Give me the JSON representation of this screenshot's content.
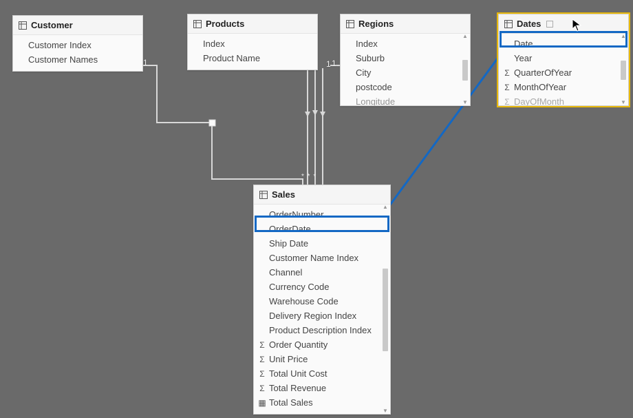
{
  "tables": {
    "customer": {
      "title": "Customer",
      "fields": [
        {
          "label": "Customer Index"
        },
        {
          "label": "Customer Names"
        }
      ]
    },
    "products": {
      "title": "Products",
      "fields": [
        {
          "label": "Index"
        },
        {
          "label": "Product Name"
        }
      ]
    },
    "regions": {
      "title": "Regions",
      "fields": [
        {
          "label": "Index"
        },
        {
          "label": "Suburb"
        },
        {
          "label": "City"
        },
        {
          "label": "postcode"
        },
        {
          "label": "Longitude"
        }
      ]
    },
    "dates": {
      "title": "Dates",
      "fields": [
        {
          "label": "Date"
        },
        {
          "label": "Year"
        },
        {
          "label": "QuarterOfYear",
          "sigma": true
        },
        {
          "label": "MonthOfYear",
          "sigma": true
        },
        {
          "label": "DayOfMonth",
          "sigma": true
        }
      ]
    },
    "sales": {
      "title": "Sales",
      "fields": [
        {
          "label": "OrderNumber"
        },
        {
          "label": "OrderDate"
        },
        {
          "label": "Ship Date"
        },
        {
          "label": "Customer Name Index"
        },
        {
          "label": "Channel"
        },
        {
          "label": "Currency Code"
        },
        {
          "label": "Warehouse Code"
        },
        {
          "label": "Delivery Region Index"
        },
        {
          "label": "Product Description Index"
        },
        {
          "label": "Order Quantity",
          "sigma": true
        },
        {
          "label": "Unit Price",
          "sigma": true
        },
        {
          "label": "Total Unit Cost",
          "sigma": true
        },
        {
          "label": "Total Revenue",
          "sigma": true
        },
        {
          "label": "Total Sales",
          "calc": true
        }
      ]
    }
  },
  "rel_labels": {
    "one_customer": "1",
    "one_products": "1",
    "one_regions": "1"
  },
  "many_markers": "*  *  *"
}
